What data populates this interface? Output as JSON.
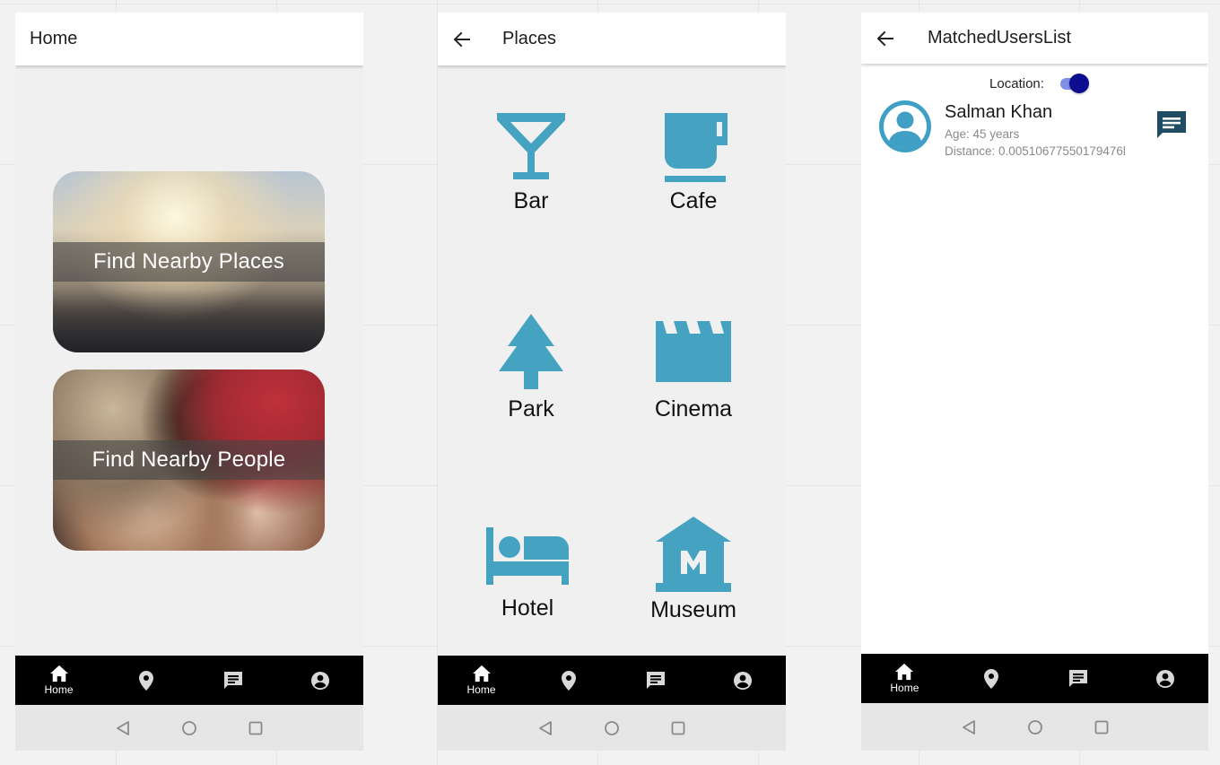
{
  "home": {
    "title": "Home",
    "cards": [
      {
        "label": "Find Nearby Places"
      },
      {
        "label": "Find Nearby People"
      }
    ]
  },
  "places": {
    "title": "Places",
    "items": [
      {
        "label": "Bar",
        "icon": "cocktail-glass-icon"
      },
      {
        "label": "Cafe",
        "icon": "coffee-cup-icon"
      },
      {
        "label": "Park",
        "icon": "tree-icon"
      },
      {
        "label": "Cinema",
        "icon": "clapperboard-icon"
      },
      {
        "label": "Hotel",
        "icon": "bed-icon"
      },
      {
        "label": "Museum",
        "icon": "museum-icon"
      }
    ],
    "icon_color": "#45a2c0"
  },
  "matched": {
    "title": "MatchedUsersList",
    "location_label": "Location:",
    "location_enabled": true,
    "users": [
      {
        "name": "Salman Khan",
        "age": "Age: 45 years",
        "distance": "Distance: 0.00510677550179476l"
      }
    ]
  },
  "nav": {
    "items": [
      {
        "label": "Home",
        "icon": "home-icon"
      },
      {
        "label": "",
        "icon": "location-pin-icon"
      },
      {
        "label": "",
        "icon": "chat-icon"
      },
      {
        "label": "",
        "icon": "account-icon"
      }
    ]
  },
  "system_bar": [
    "back-triangle-icon",
    "home-circle-icon",
    "recents-square-icon"
  ],
  "colors": {
    "accent": "#45a2c0",
    "avatar": "#3f9fc4",
    "chat_button": "#1f4c63",
    "toggle_thumb": "#0d0d8f",
    "toggle_track": "#7f8fe8"
  }
}
